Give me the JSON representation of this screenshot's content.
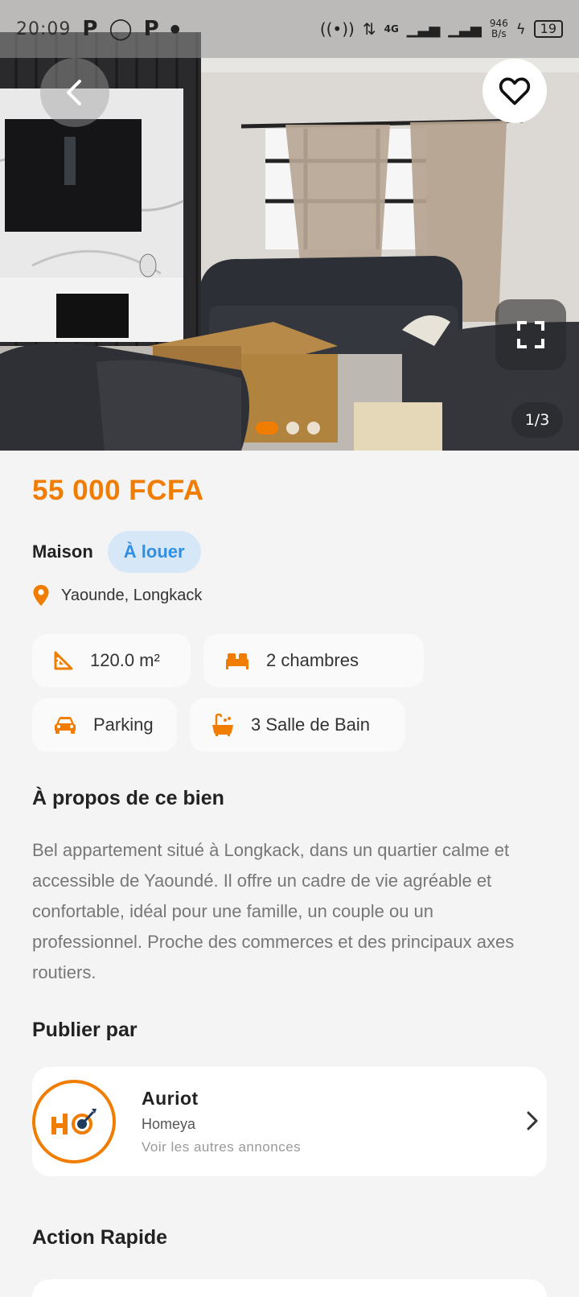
{
  "status_bar": {
    "time": "20:09",
    "network_type": "4G",
    "speed_value": "946",
    "speed_unit": "B/s",
    "battery": "19"
  },
  "gallery": {
    "counter": "1/3",
    "total_images": 3,
    "active_index": 0
  },
  "listing": {
    "price": "55 000 FCFA",
    "type": "Maison",
    "status_badge": "À louer",
    "location": "Yaounde, Longkack",
    "features": {
      "area": "120.0 m²",
      "rooms": "2 chambres",
      "parking": "Parking",
      "bathrooms": "3 Salle de Bain"
    }
  },
  "about": {
    "title": "À propos de ce bien",
    "description": "Bel appartement situé à Longkack, dans un quartier calme et accessible de Yaoundé. Il offre un cadre de vie agréable et confortable, idéal pour une famille, un couple ou un professionnel. Proche des commerces et des principaux axes routiers."
  },
  "publisher": {
    "section_title": "Publier par",
    "name": "Auriot",
    "company": "Homeya",
    "link": "Voir les autres annonces"
  },
  "quick_action": {
    "title": "Action Rapide"
  },
  "colors": {
    "accent": "#f07d00",
    "badge_bg": "#d6e8f7",
    "badge_text": "#2f8fe6",
    "background": "#f4f4f4"
  },
  "icons": {
    "back": "chevron-left-icon",
    "favorite": "heart-icon",
    "fullscreen": "expand-icon",
    "location": "map-pin-icon",
    "area": "ruler-triangle-icon",
    "rooms": "bed-icon",
    "parking": "car-icon",
    "bathrooms": "bathtub-icon",
    "publisher_next": "chevron-right-icon"
  }
}
